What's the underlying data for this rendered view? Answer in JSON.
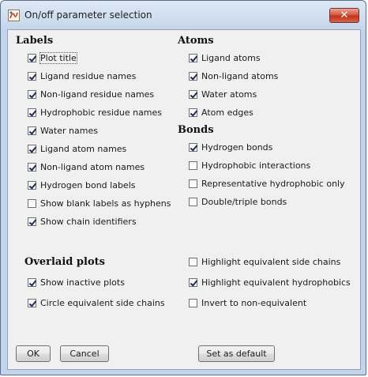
{
  "window": {
    "title": "On/off parameter selection",
    "close_symbol": "✕"
  },
  "labels_section": {
    "heading": "Labels",
    "items": [
      {
        "label": "Plot title",
        "checked": true
      },
      {
        "label": "Ligand residue names",
        "checked": true
      },
      {
        "label": "Non-ligand residue names",
        "checked": true
      },
      {
        "label": "Hydrophobic residue names",
        "checked": true
      },
      {
        "label": "Water names",
        "checked": true
      },
      {
        "label": "Ligand atom names",
        "checked": true
      },
      {
        "label": "Non-ligand atom names",
        "checked": true
      },
      {
        "label": "Hydrogen bond labels",
        "checked": true
      },
      {
        "label": "Show blank labels as hyphens",
        "checked": false
      },
      {
        "label": "Show chain identifiers",
        "checked": true
      }
    ]
  },
  "atoms_section": {
    "heading": "Atoms",
    "items": [
      {
        "label": "Ligand atoms",
        "checked": true
      },
      {
        "label": "Non-ligand atoms",
        "checked": true
      },
      {
        "label": "Water atoms",
        "checked": true
      },
      {
        "label": "Atom edges",
        "checked": true
      }
    ]
  },
  "bonds_section": {
    "heading": "Bonds",
    "items": [
      {
        "label": "Hydrogen bonds",
        "checked": true
      },
      {
        "label": "Hydrophobic interactions",
        "checked": false
      },
      {
        "label": "Representative hydrophobic only",
        "checked": false
      },
      {
        "label": "Double/triple bonds",
        "checked": false
      }
    ]
  },
  "overlaid_section": {
    "heading": "Overlaid plots",
    "left_items": [
      {
        "label": "Show inactive plots",
        "checked": true
      },
      {
        "label": "Circle equivalent side chains",
        "checked": true
      }
    ],
    "right_items": [
      {
        "label": "Highlight equivalent side chains",
        "checked": false
      },
      {
        "label": "Highlight equivalent hydrophobics",
        "checked": true
      },
      {
        "label": "Invert to non-equivalent",
        "checked": false
      }
    ]
  },
  "buttons": {
    "ok": "OK",
    "cancel": "Cancel",
    "set_default": "Set as default"
  }
}
